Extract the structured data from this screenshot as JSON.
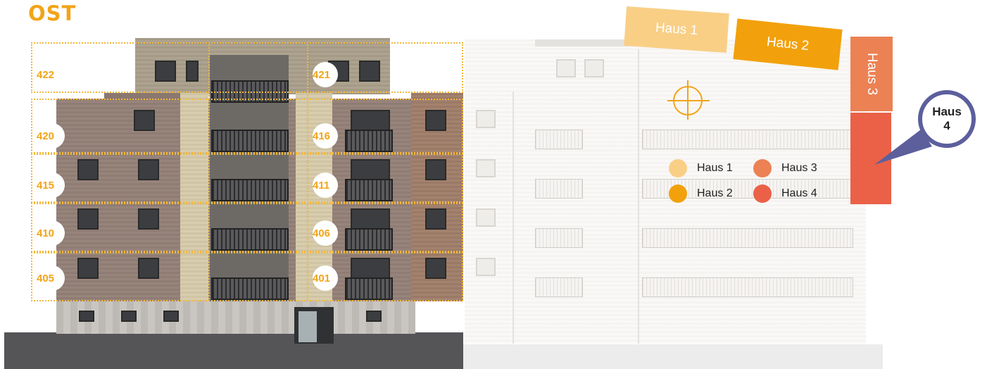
{
  "view_title": "OST",
  "units": [
    "422",
    "421",
    "420",
    "416",
    "415",
    "411",
    "410",
    "406",
    "405",
    "401"
  ],
  "site_plan": {
    "buildings": [
      {
        "label": "Haus 1",
        "color": "#f9cf86"
      },
      {
        "label": "Haus 2",
        "color": "#f2a10c"
      },
      {
        "label": "Haus 3",
        "color": "#ec8154"
      },
      {
        "label": "Haus 4",
        "color": "#ea6148"
      }
    ],
    "pin": {
      "line1": "Haus",
      "line2": "4",
      "color": "#5c5f9c"
    }
  },
  "legend": [
    {
      "label": "Haus 1",
      "color": "#f9cf86"
    },
    {
      "label": "Haus 3",
      "color": "#ec8154"
    },
    {
      "label": "Haus 2",
      "color": "#f2a10c"
    },
    {
      "label": "Haus 4",
      "color": "#ea6148"
    }
  ],
  "accent_color": "#f2a418"
}
